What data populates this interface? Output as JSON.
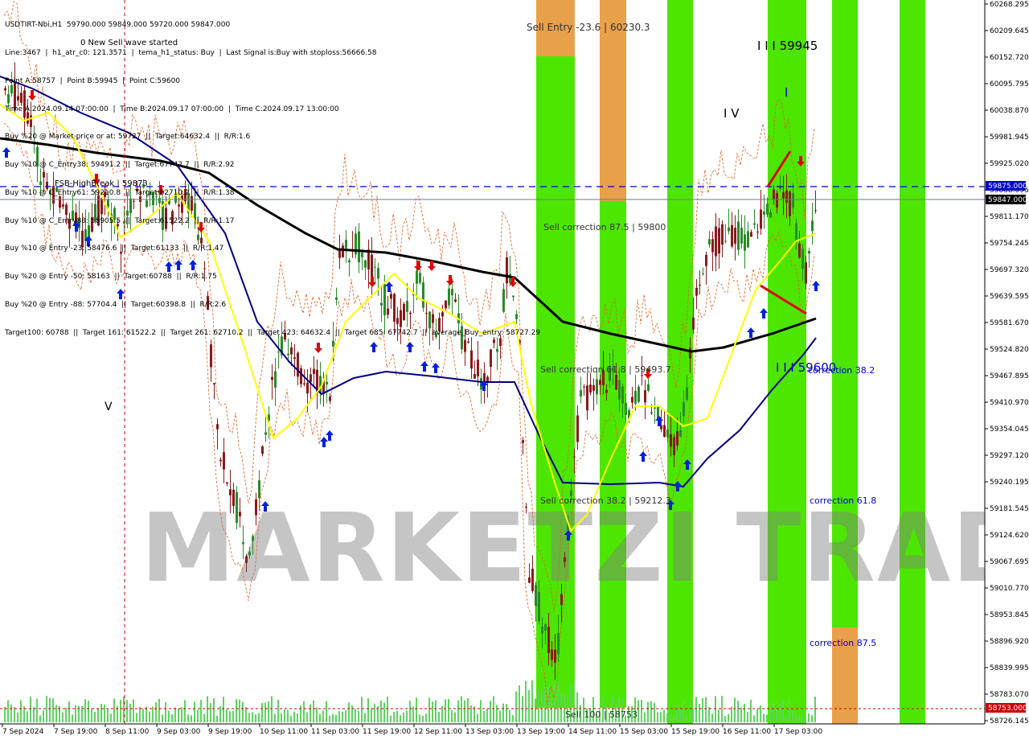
{
  "symbol_line": "USDTIRT-Nbi,H1  59790.000 59849.000 59720.000 59847.000",
  "info_lines": [
    "Line:3467  |  h1_atr_c0: 121.3571  |  tema_h1_status: Buy  |  Last Signal is:Buy with stoploss:56666.58",
    "Point A:58757  |  Point B:59945  |  Point C:59600",
    "Time A:2024.09.14 07:00:00  |  Time B:2024.09.17 07:00:00  |  Time C:2024.09.17 13:00:00",
    "Buy %20 @ Market price or at: 59727  ||  Target:64632.4  ||  R/R:1.6",
    "Buy %10 @ C_Entry38: 59491.2  ||  Target:67742.7  ||  R/R:2.92",
    "Buy %10 @ C_Entry61: 59210.8  ||  Target:62710.2  ||  R/R:1.38",
    "Buy %10 @ C_Entry88: 58905.5  ||  Target:61522.2  ||  R/R:1.17",
    "Buy %10 @ Entry -23: 58476.6  ||  Target:61133  ||  R/R:1.47",
    "Buy %20 @ Entry -50: 58163  ||  Target:60788  ||  R/R:1.75",
    "Buy %20 @ Entry -88: 57704.4  ||  Target:60398.8  ||  R/R:2.6",
    "Target100: 60788  ||  Target 161: 61522.2  ||  Target 261: 62710.2  ||  Target 423: 64632.4  ||  Target 685: 67742.7  ||  average_Buy_entry: 58727.29"
  ],
  "new_wave_text": "0 New Sell wave started",
  "fsb_text": "FSB-HighBreak | 59873",
  "annotations": {
    "sell_entry": "Sell Entry -23.6 | 60230.3",
    "sell_corr_875": "Sell correction 87.5 | 59800",
    "sell_corr_618": "Sell correction 61.8 | 59493.7",
    "sell_corr_382": "Sell correction 38.2 | 59212.3",
    "sell_100": "Sell 100 | 58753",
    "correction_382": "correction 38.2",
    "correction_618": "correction 61.8",
    "correction_875": "correction 87.5",
    "wave_III": "I I I 59945",
    "wave_IV": "I V",
    "wave_I": "I",
    "wave_C": "I I I 59600",
    "wave_V": "V"
  },
  "watermark": "MARKETZI TRADE",
  "price_axis": {
    "labels": [
      "60268.295",
      "60209.645",
      "60152.720",
      "60095.795",
      "60038.870",
      "59981.945",
      "59925.020",
      "59868.095",
      "59811.170",
      "59754.245",
      "59697.320",
      "59639.595",
      "59581.670",
      "59524.820",
      "59467.895",
      "59410.970",
      "59354.045",
      "59297.120",
      "59240.195",
      "59181.545",
      "59124.620",
      "59067.695",
      "59010.770",
      "58953.845",
      "58896.920",
      "58839.995",
      "58783.070",
      "58726.145"
    ],
    "y": [
      5,
      38,
      71,
      104,
      137,
      170,
      203,
      236,
      269,
      302,
      335,
      368,
      401,
      434,
      467,
      500,
      533,
      566,
      599,
      632,
      665,
      698,
      731,
      764,
      797,
      830,
      863,
      896
    ],
    "current_price": "59847.000",
    "fsb_price": "59875.000",
    "sell100_price": "58753.000"
  },
  "time_axis": [
    "7 Sep 2024",
    "7 Sep 19:00",
    "8 Sep 11:00",
    "9 Sep 03:00",
    "9 Sep 19:00",
    "10 Sep 11:00",
    "11 Sep 03:00",
    "11 Sep 19:00",
    "12 Sep 11:00",
    "13 Sep 03:00",
    "13 Sep 19:00",
    "14 Sep 11:00",
    "15 Sep 03:00",
    "15 Sep 19:00",
    "16 Sep 11:00",
    "17 Sep 03:00"
  ],
  "colors": {
    "bull": "#2a8a2a",
    "bear": "#8b1a1a",
    "ema_fast": "#ffff00",
    "ema_mid": "#000080",
    "ema_slow": "#000000",
    "band_green": "#4de600",
    "band_orange": "#e8a04a",
    "blue_dash": "#0000cc",
    "red_line": "#e00000"
  },
  "chart_data": {
    "type": "candlestick",
    "ylim": [
      58726.145,
      60268.295
    ],
    "last": {
      "open": 59790.0,
      "high": 59849.0,
      "low": 59720.0,
      "close": 59847.0
    },
    "levels": {
      "fsb_high_break": 59873,
      "sell_entry": 60230.3,
      "sell_corr_875": 59800,
      "sell_corr_618": 59493.7,
      "sell_corr_382": 59212.3,
      "sell_100": 58753
    },
    "points": {
      "A": 58757,
      "B": 59945,
      "C": 59600
    }
  }
}
